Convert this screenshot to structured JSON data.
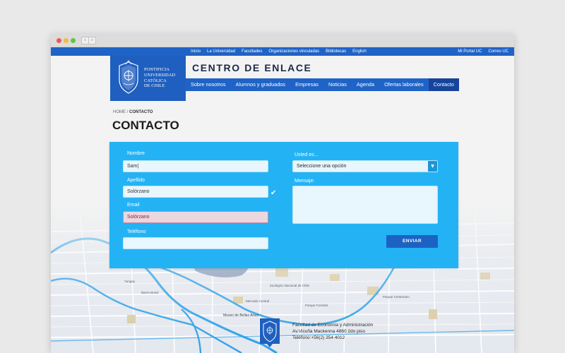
{
  "browser": {
    "controls": {
      "back_icon": "‹",
      "forward_icon": "›"
    }
  },
  "topbar": {
    "links": [
      "Inicio",
      "La Universidad",
      "Facultades",
      "Organizaciones vinculadas",
      "Bibliotecas",
      "English"
    ],
    "right_links": [
      "Mi Portal UC",
      "Correo UC"
    ]
  },
  "logo": {
    "lines": [
      "PONTIFICIA",
      "UNIVERSIDAD",
      "CATÓLICA",
      "DE CHILE"
    ]
  },
  "site_title": "CENTRO DE ENLACE",
  "main_nav": [
    {
      "label": "Sobre nosotros",
      "active": false
    },
    {
      "label": "Alumnos y graduados",
      "active": false
    },
    {
      "label": "Empresas",
      "active": false
    },
    {
      "label": "Noticias",
      "active": false
    },
    {
      "label": "Agenda",
      "active": false
    },
    {
      "label": "Ofertas laborales",
      "active": false
    },
    {
      "label": "Contacto",
      "active": true
    }
  ],
  "breadcrumb": {
    "home": "HOME",
    "separator": " / ",
    "current": "CONTACTO"
  },
  "page_title": "CONTACTO",
  "form": {
    "nombre_label": "Nombre",
    "nombre_value": "Sam|",
    "apellido_label": "Apellido",
    "apellido_value": "Solórzano",
    "apellido_valid_icon": "✔",
    "email_label": "Email",
    "email_value": "Solórzano",
    "telefono_label": "Teléfono",
    "telefono_value": "",
    "usted_label": "Usted es...",
    "usted_value": "Seleccione una opción",
    "usted_arrow_icon": "▼",
    "mensaje_label": "Mensaje:",
    "mensaje_value": "",
    "submit_label": "ENVIAR"
  },
  "map": {
    "labels": [
      "Yungay",
      "Barrio Brasil",
      "Museo de Bellas Artes",
      "Parque Forestal",
      "Mercado Central",
      "Zoológico Nacional de Chile",
      "Parque Centenario"
    ]
  },
  "address": {
    "line1": "Facultad de Economía y Administración",
    "line2": "Av.Vicuña Mackenna 4860 2do piso",
    "line3": "Teléfono:+56(2) 354 4012"
  },
  "colors": {
    "topbar": "#1f63c6",
    "nav_active": "#17449b",
    "panel": "#23b3f5",
    "button": "#1c62c3",
    "error_field": "#ebd7e0"
  }
}
